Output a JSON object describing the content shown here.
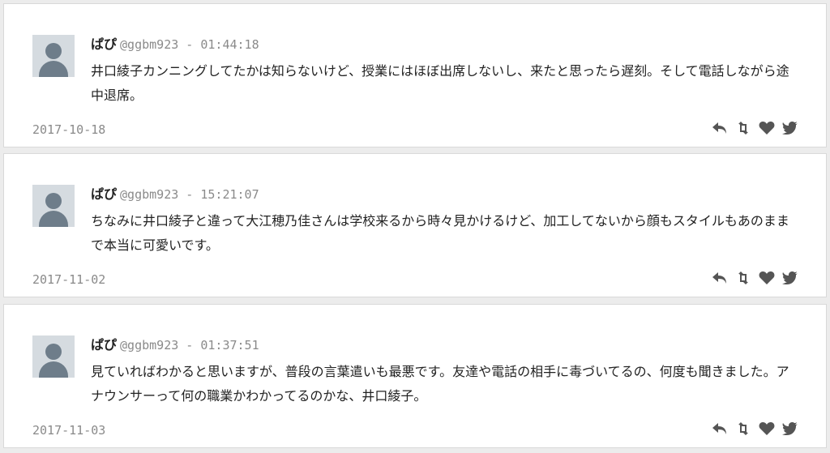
{
  "comments": [
    {
      "name": "ぱぴ",
      "handle": "@ggbm923",
      "sep": " - ",
      "time": "01:44:18",
      "text": "井口綾子カンニングしてたかは知らないけど、授業にはほぼ出席しないし、来たと思ったら遅刻。そして電話しながら途中退席。",
      "date": "2017-10-18"
    },
    {
      "name": "ぱぴ",
      "handle": "@ggbm923",
      "sep": " - ",
      "time": "15:21:07",
      "text": "ちなみに井口綾子と違って大江穂乃佳さんは学校来るから時々見かけるけど、加工してないから顔もスタイルもあのままで本当に可愛いです。",
      "date": "2017-11-02"
    },
    {
      "name": "ぱぴ",
      "handle": "@ggbm923",
      "sep": " - ",
      "time": "01:37:51",
      "text": "見ていればわかると思いますが、普段の言葉遣いも最悪です。友達や電話の相手に毒づいてるの、何度も聞きました。アナウンサーって何の職業かわかってるのかな、井口綾子。",
      "date": "2017-11-03"
    }
  ],
  "icons": {
    "reply": "reply-icon",
    "retweet": "retweet-icon",
    "like": "heart-icon",
    "twitter": "twitter-icon",
    "avatar": "default-avatar-icon"
  },
  "colors": {
    "background": "#ececec",
    "card": "#ffffff",
    "muted": "#8a8a8a",
    "text": "#222222",
    "icon": "#555555",
    "avatar_bg": "#d5dbe0",
    "avatar_fg": "#6e7d8a"
  }
}
